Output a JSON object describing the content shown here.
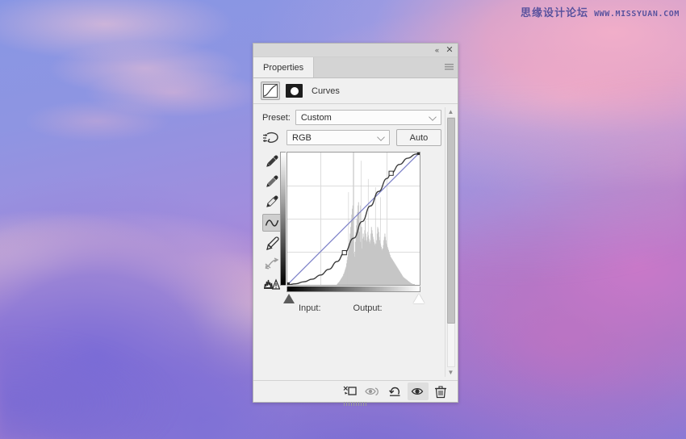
{
  "watermark": {
    "chinese": "思缘设计论坛",
    "url": "WWW.MISSYUAN.COM"
  },
  "panel": {
    "titlebar": {
      "collapse_label": "«",
      "close_label": "✕"
    },
    "tabs": [
      {
        "label": "Properties",
        "active": true
      }
    ],
    "menu_icon": "panel-menu-icon",
    "adjustment": {
      "title": "Curves",
      "curves_icon": "curves-icon",
      "mask_icon": "layer-mask-icon"
    },
    "preset": {
      "label": "Preset:",
      "value": "Custom"
    },
    "channel": {
      "value": "RGB",
      "auto_label": "Auto",
      "target_icon": "on-image-adjust-icon"
    },
    "tools": [
      {
        "name": "sample-in-image-icon",
        "active": false
      },
      {
        "name": "black-point-eyedropper-icon",
        "active": false
      },
      {
        "name": "gray-point-eyedropper-icon",
        "active": false
      },
      {
        "name": "white-point-eyedropper-icon",
        "active": false
      },
      {
        "name": "curve-point-tool-icon",
        "active": true
      },
      {
        "name": "pencil-draw-tool-icon",
        "active": false
      },
      {
        "name": "smooth-curve-icon",
        "active": false
      },
      {
        "name": "curve-display-options-icon",
        "active": false
      }
    ],
    "fields": {
      "input_label": "Input:",
      "output_label": "Output:",
      "input_value": "",
      "output_value": ""
    },
    "footer": [
      {
        "name": "clip-to-layer-button"
      },
      {
        "name": "view-previous-state-button"
      },
      {
        "name": "reset-button"
      },
      {
        "name": "toggle-layer-visibility-button",
        "active": true
      },
      {
        "name": "delete-layer-button"
      }
    ],
    "colors": {
      "panel_bg": "#f0f0f0",
      "tab_bg": "#d4d4d4",
      "curve_line": "#3c3c3c",
      "baseline": "#7b7fc8",
      "histogram": "#c6c6c6"
    }
  },
  "chart_data": {
    "type": "line",
    "title": "Curves",
    "xlabel": "Input",
    "ylabel": "Output",
    "xlim": [
      0,
      255
    ],
    "ylim": [
      0,
      255
    ],
    "grid": true,
    "grid_divisions": 4,
    "legend": "none",
    "series": [
      {
        "name": "RGB curve",
        "color": "#3c3c3c",
        "control_points": [
          {
            "input": 0,
            "output": 0
          },
          {
            "input": 110,
            "output": 62
          },
          {
            "input": 200,
            "output": 215
          },
          {
            "input": 255,
            "output": 255
          }
        ],
        "curve_points": [
          [
            0,
            0
          ],
          [
            16,
            2
          ],
          [
            32,
            6
          ],
          [
            48,
            11
          ],
          [
            64,
            19
          ],
          [
            80,
            30
          ],
          [
            96,
            45
          ],
          [
            110,
            62
          ],
          [
            128,
            90
          ],
          [
            144,
            122
          ],
          [
            160,
            152
          ],
          [
            176,
            180
          ],
          [
            192,
            205
          ],
          [
            200,
            215
          ],
          [
            216,
            232
          ],
          [
            232,
            244
          ],
          [
            248,
            252
          ],
          [
            255,
            255
          ]
        ]
      },
      {
        "name": "baseline diagonal",
        "color": "#7b7fc8",
        "control_points": [
          {
            "input": 0,
            "output": 0
          },
          {
            "input": 255,
            "output": 255
          }
        ]
      }
    ],
    "histogram": {
      "color": "#c6c6c6",
      "bins": [
        0,
        0,
        0,
        0,
        0,
        0,
        0,
        0,
        0,
        0,
        0,
        0,
        0,
        0,
        0,
        0,
        0,
        0,
        0,
        0,
        0,
        0,
        0,
        0,
        0,
        0,
        0,
        0,
        0,
        0,
        0,
        0,
        0,
        0,
        0,
        0,
        0,
        0,
        0,
        0,
        0,
        0,
        0,
        0,
        0,
        0,
        0,
        0,
        0,
        0,
        0,
        0,
        0,
        0,
        0,
        0,
        0,
        0,
        0,
        0,
        0,
        0,
        0,
        0,
        0,
        0,
        0,
        0,
        0,
        0,
        0,
        0,
        0,
        0,
        0,
        0,
        0,
        0,
        0,
        0,
        0,
        0,
        0,
        0,
        0,
        0,
        0,
        0,
        0,
        0,
        0,
        0,
        0,
        0,
        0,
        0,
        1,
        2,
        3,
        3,
        4,
        5,
        6,
        7,
        8,
        9,
        10,
        11,
        13,
        14,
        16,
        18,
        20,
        22,
        26,
        30,
        34,
        38,
        42,
        48,
        55,
        62,
        70,
        78,
        85,
        92,
        96,
        58,
        38,
        34,
        40,
        52,
        64,
        72,
        80,
        88,
        96,
        100,
        88,
        64,
        52,
        96,
        52,
        70,
        44,
        56,
        62,
        58,
        54,
        66,
        78,
        62,
        54,
        52,
        58,
        64,
        60,
        56,
        52,
        50,
        54,
        62,
        70,
        66,
        62,
        58,
        55,
        52,
        50,
        48,
        46,
        50,
        54,
        62,
        70,
        68,
        64,
        58,
        54,
        50,
        48,
        46,
        44,
        42,
        44,
        48,
        54,
        58,
        62,
        58,
        54,
        50,
        48,
        46,
        44,
        42,
        40,
        38,
        36,
        34,
        33,
        32,
        31,
        30,
        29,
        28,
        27,
        26,
        25,
        24,
        23,
        22,
        21,
        20,
        19,
        18,
        17,
        16,
        15,
        14,
        13,
        12,
        11,
        10,
        9,
        9,
        8,
        8,
        7,
        7,
        6,
        6,
        5,
        5,
        4,
        4,
        3,
        3,
        2,
        2,
        2,
        1,
        1,
        1,
        1,
        1,
        0,
        0,
        0,
        0,
        0,
        0,
        0,
        0,
        0,
        0
      ],
      "spikes": [
        {
          "bin": 127,
          "height": 160
        },
        {
          "bin": 142,
          "height": 150
        },
        {
          "bin": 156,
          "height": 128
        },
        {
          "bin": 118,
          "height": 112
        },
        {
          "bin": 170,
          "height": 118
        },
        {
          "bin": 180,
          "height": 106
        }
      ]
    },
    "black_point_slider": 0,
    "white_point_slider": 255
  }
}
